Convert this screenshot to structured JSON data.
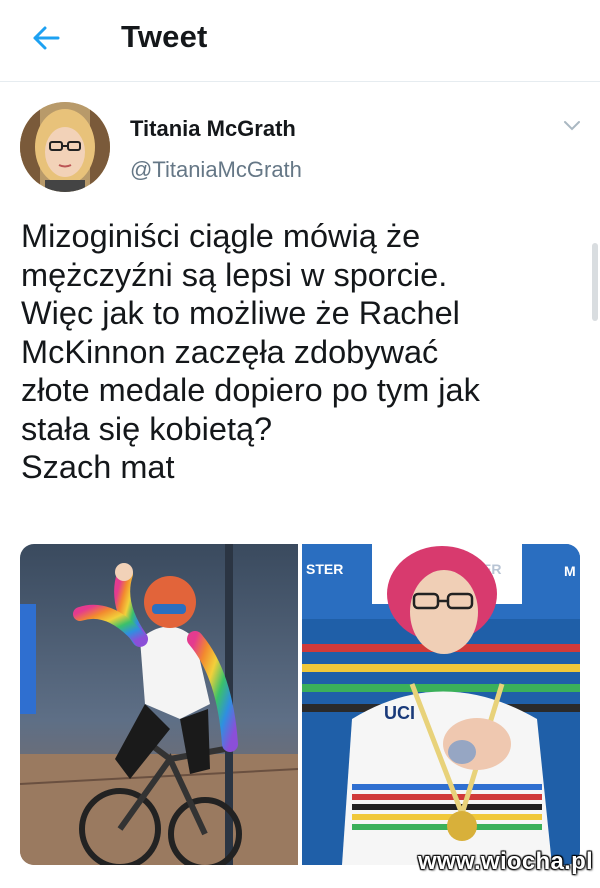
{
  "header": {
    "title": "Tweet",
    "back_icon": "arrow-left-icon",
    "accent_color": "#1da1f2"
  },
  "tweet": {
    "author": {
      "display_name": "Titania McGrath",
      "handle": "@TitaniaMcGrath",
      "menu_icon": "chevron-down-icon"
    },
    "text_lines": [
      "Mizoginiści ciągle mówią że",
      "mężczyźni są lepsi w sporcie.",
      "Więc jak to możliwe że Rachel",
      "McKinnon zaczęła zdobywać",
      "złote medale dopiero po tym jak",
      "stała się kobietą?",
      "Szach mat"
    ],
    "media": [
      {
        "name": "cyclist-on-track-photo"
      },
      {
        "name": "medal-ceremony-photo",
        "jersey_text": "UCI",
        "signage": [
          "STER",
          "ER",
          "M"
        ]
      }
    ]
  },
  "watermark": "www.wiocha.pl"
}
